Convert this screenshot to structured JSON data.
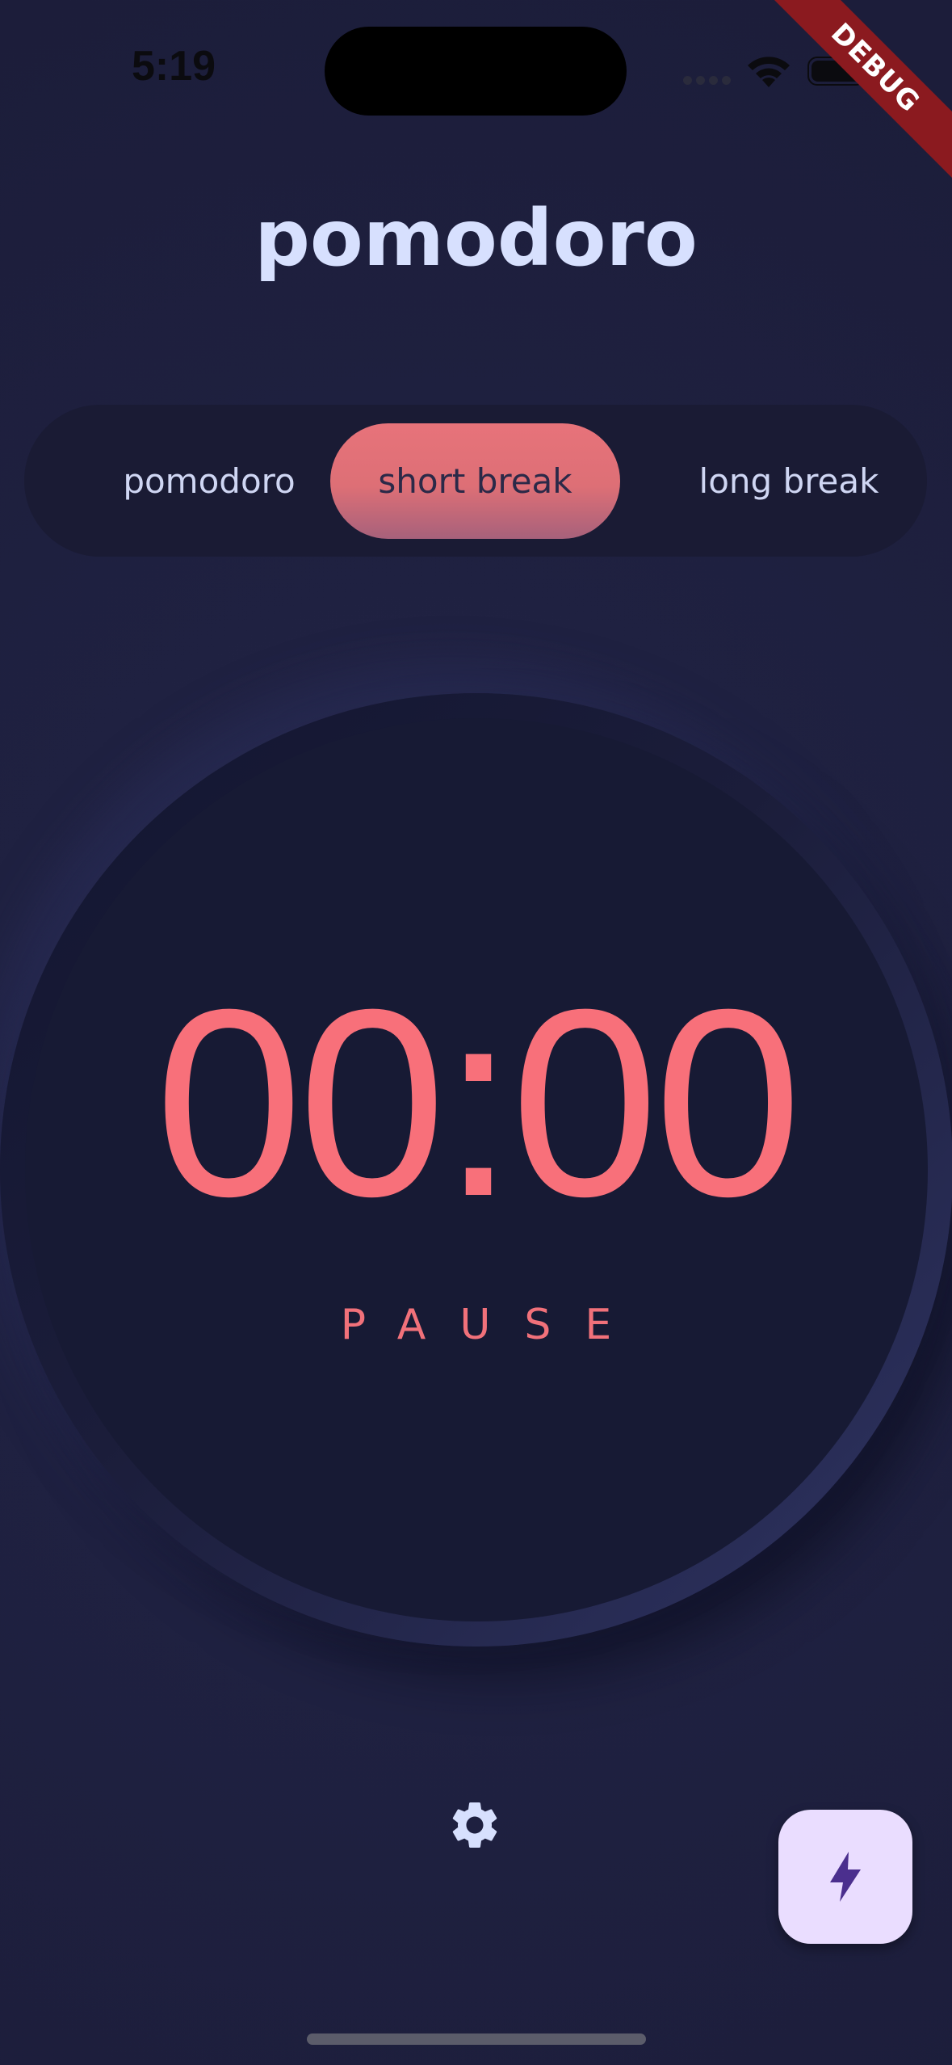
{
  "status_bar": {
    "time": "5:19"
  },
  "debug_banner": "DEBUG",
  "app": {
    "title": "pomodoro"
  },
  "modes": {
    "items": [
      {
        "label": "pomodoro"
      },
      {
        "label": "short break"
      },
      {
        "label": "long break"
      }
    ],
    "selected": "short break"
  },
  "timer": {
    "time": "00:00",
    "action_label": "PAUSE"
  },
  "icons": {
    "settings": "gear-icon",
    "fab": "bolt-icon"
  },
  "colors": {
    "accent": "#f8707a",
    "text_light": "#d7e0fe",
    "fab_background": "#eaddff",
    "fab_icon": "#4b2f8e"
  }
}
